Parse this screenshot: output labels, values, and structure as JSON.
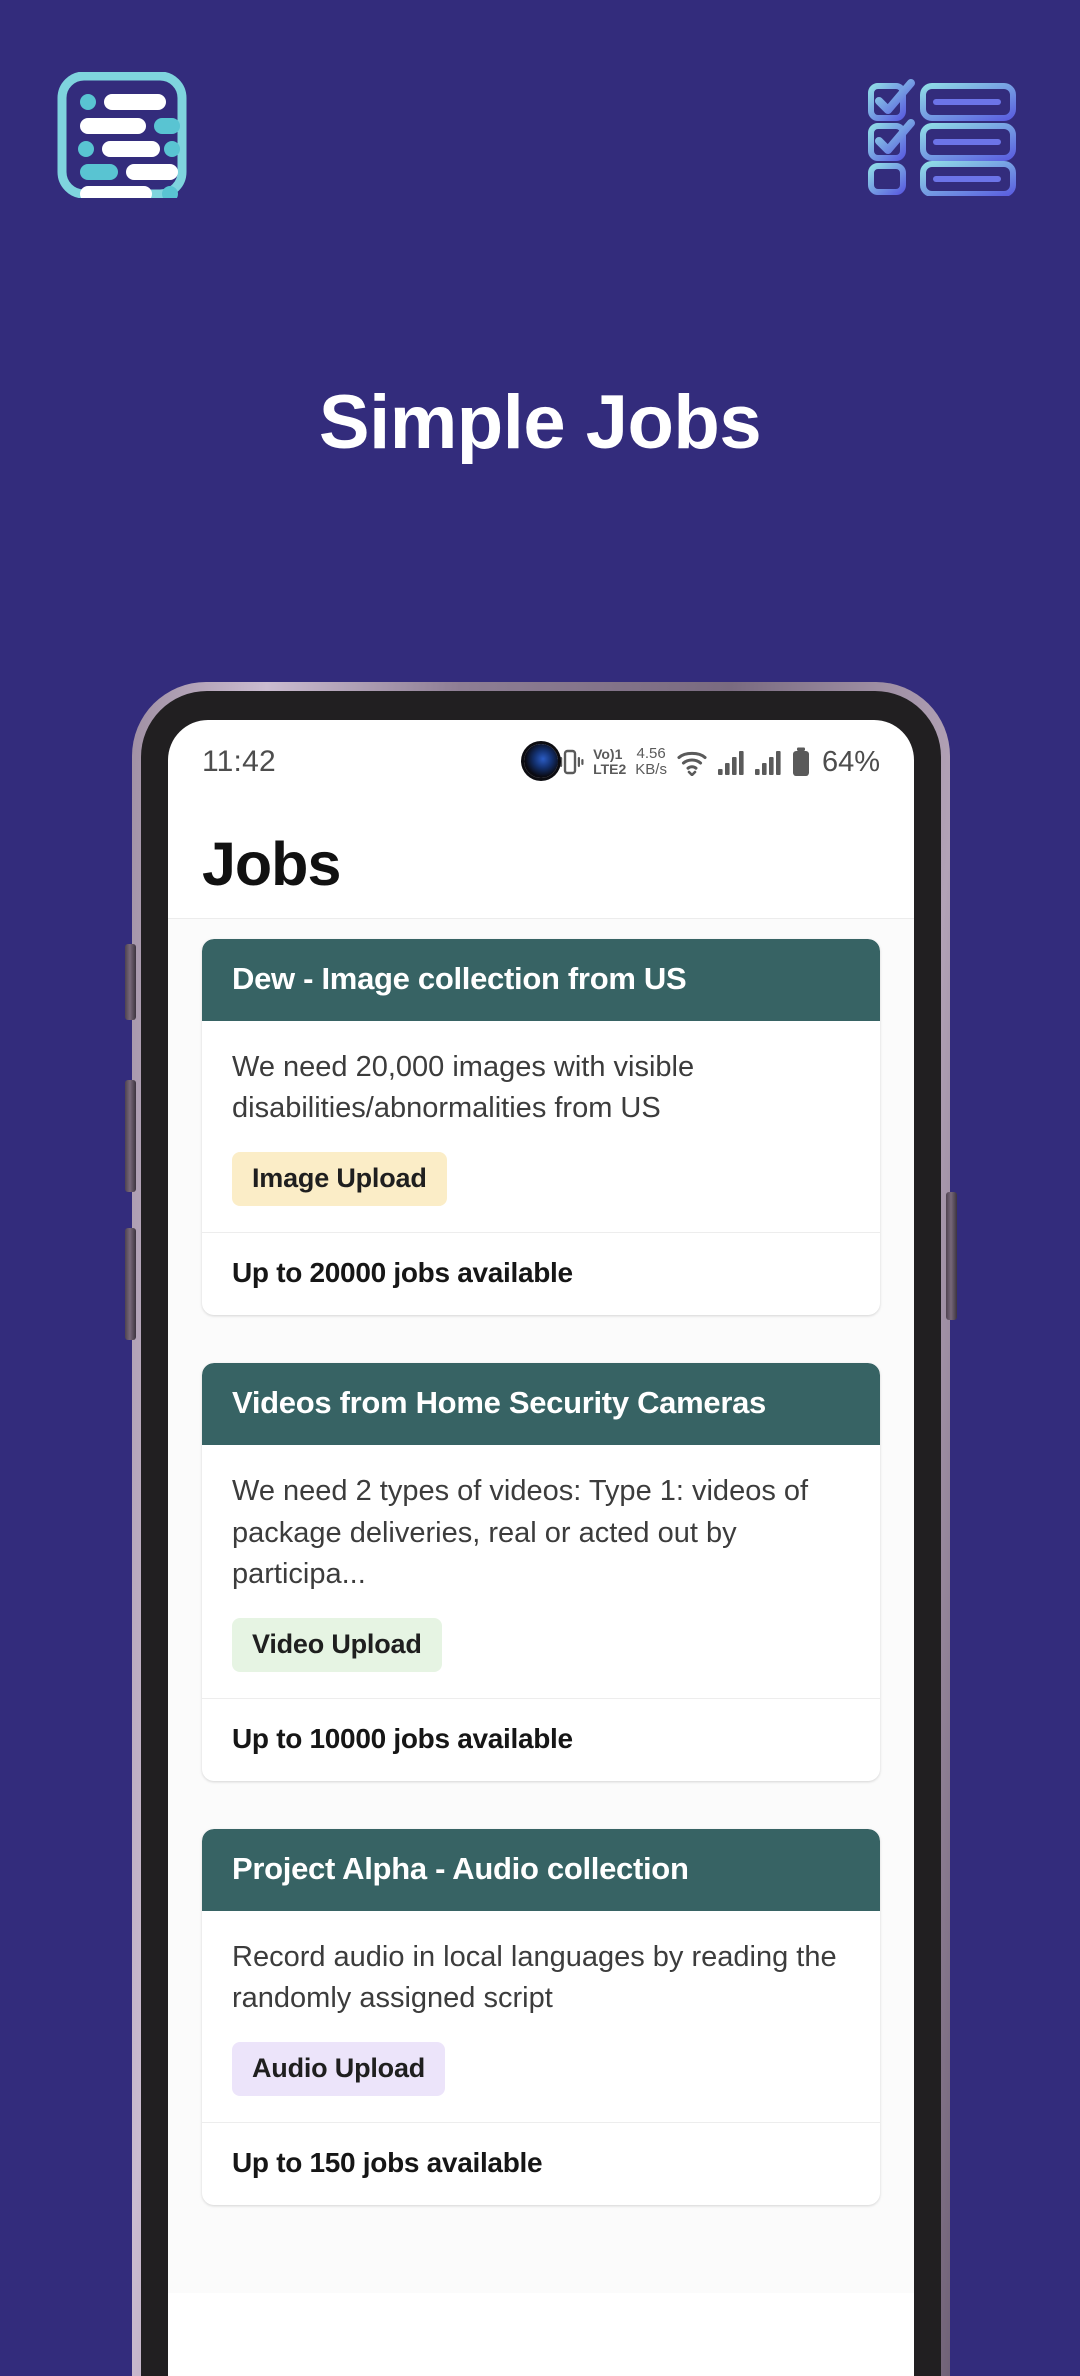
{
  "promo": {
    "title": "Simple Jobs",
    "background_color": "#332c7c",
    "left_icon": "document-lines-icon",
    "right_icon": "checklist-icon"
  },
  "phone": {
    "statusbar": {
      "time": "11:42",
      "icons": [
        "vibrate-icon",
        "volte-icon",
        "network-speed",
        "wifi-icon",
        "signal-sim1-icon",
        "signal-sim2-icon",
        "battery-icon"
      ],
      "volte_top": "Vo)1",
      "volte_bottom": "LTE2",
      "net_speed_value": "4.56",
      "net_speed_unit": "KB/s",
      "battery_percent": "64%"
    },
    "appbar": {
      "title": "Jobs"
    },
    "jobs": [
      {
        "title": "Dew - Image collection from US",
        "description": "We need 20,000 images with visible disabilities/abnormalities from US",
        "badge_label": "Image Upload",
        "badge_bg": "#fbedc7",
        "footer": "Up to 20000 jobs available"
      },
      {
        "title": "Videos from Home Security Cameras",
        "description": "We need 2 types of videos:  Type 1: videos of package deliveries, real or acted out by participa...",
        "badge_label": "Video Upload",
        "badge_bg": "#e6f4e3",
        "footer": "Up to 10000 jobs available"
      },
      {
        "title": "Project Alpha - Audio collection",
        "description": "Record audio in local languages by reading the randomly assigned script",
        "badge_label": "Audio Upload",
        "badge_bg": "#ece4fa",
        "footer": "Up to 150 jobs available"
      }
    ]
  },
  "colors": {
    "card_header": "#376364",
    "promo_bg": "#332c7c",
    "icon_teal": "#7fd4de",
    "icon_blue": "#5b5fe0"
  }
}
